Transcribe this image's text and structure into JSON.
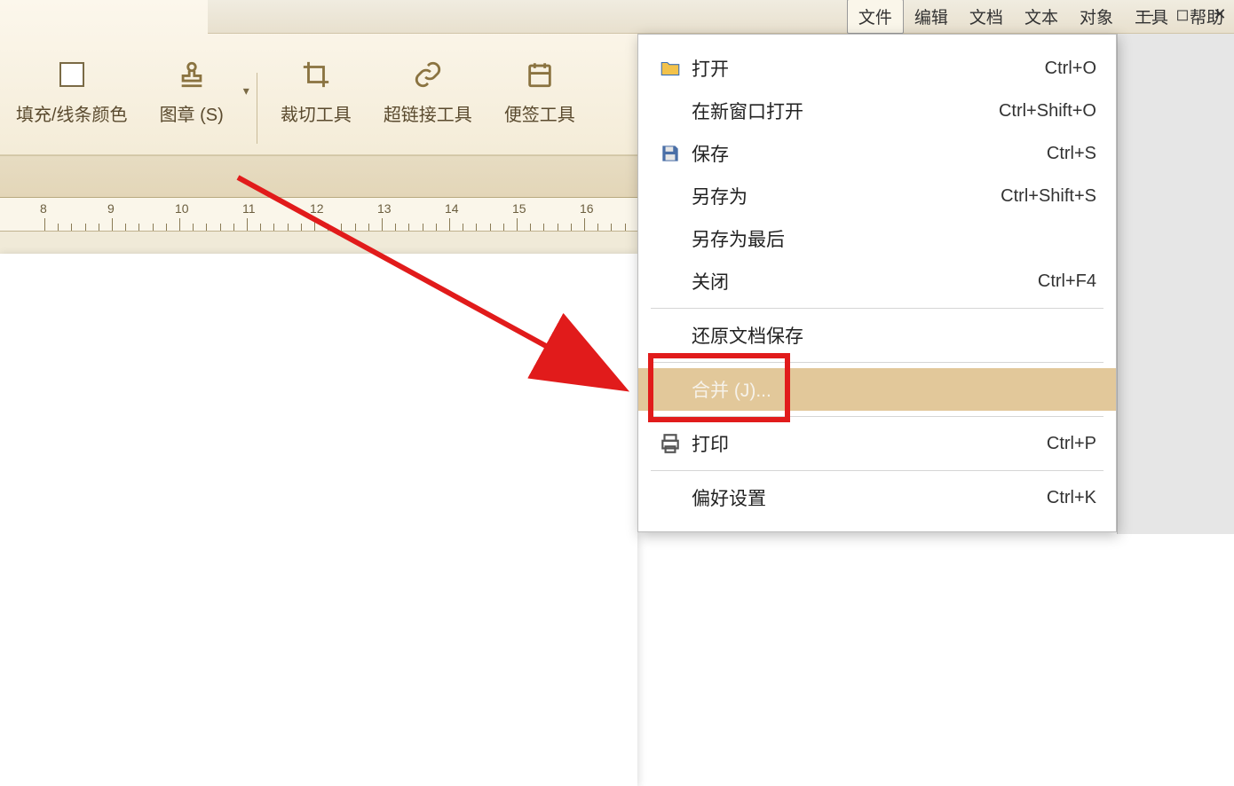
{
  "menubar": {
    "items": [
      "文件",
      "编辑",
      "文档",
      "文本",
      "对象",
      "工具",
      "帮助"
    ],
    "active_index": 0
  },
  "toolbar": {
    "fill_label": "填充/线条颜色",
    "stamp_label": "图章 (S)",
    "crop_label": "裁切工具",
    "link_label": "超链接工具",
    "note_label": "便签工具"
  },
  "ruler": {
    "numbers": [
      "8",
      "9",
      "10",
      "11",
      "12",
      "13",
      "14",
      "15",
      "16"
    ]
  },
  "file_menu": {
    "open": {
      "label": "打开",
      "accel": "Ctrl+O"
    },
    "open_new": {
      "label": "在新窗口打开",
      "accel": "Ctrl+Shift+O"
    },
    "save": {
      "label": "保存",
      "accel": "Ctrl+S"
    },
    "save_as": {
      "label": "另存为",
      "accel": "Ctrl+Shift+S"
    },
    "save_last": {
      "label": "另存为最后",
      "accel": ""
    },
    "close": {
      "label": "关闭",
      "accel": "Ctrl+F4"
    },
    "revert": {
      "label": "还原文档保存",
      "accel": ""
    },
    "merge": {
      "label": "合并 (J)...",
      "accel": ""
    },
    "print": {
      "label": "打印",
      "accel": "Ctrl+P"
    },
    "prefs": {
      "label": "偏好设置",
      "accel": "Ctrl+K"
    }
  },
  "colors": {
    "accent": "#e2c89a",
    "red": "#e11b1b"
  }
}
